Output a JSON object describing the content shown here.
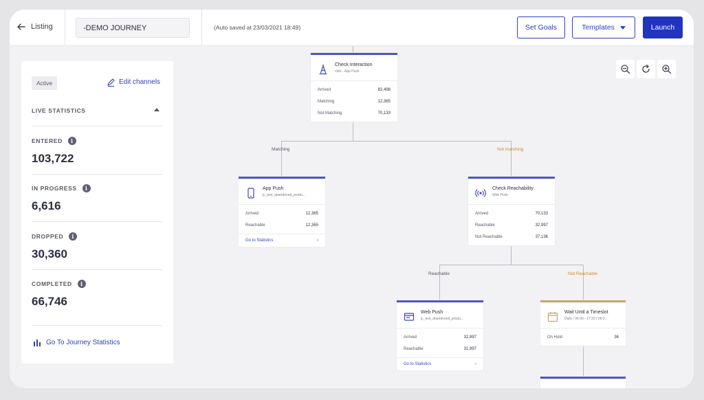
{
  "header": {
    "back_label": "Listing",
    "journey_name": "-DEMO JOURNEY",
    "autosave": "(Auto saved at 23/03/2021 18:49)",
    "set_goals_label": "Set Goals",
    "templates_label": "Templates",
    "launch_label": "Launch"
  },
  "sidebar": {
    "status_badge": "Active",
    "edit_channels_label": "Edit channels",
    "live_statistics_label": "LIVE STATISTICS",
    "stats": [
      {
        "label": "ENTERED",
        "value": "103,722"
      },
      {
        "label": "IN PROGRESS",
        "value": "6,616"
      },
      {
        "label": "DROPPED",
        "value": "30,360"
      },
      {
        "label": "COMPLETED",
        "value": "66,746"
      }
    ],
    "journey_stats_link": "Go To Journey Statistics"
  },
  "canvas": {
    "branches": {
      "matching": "Matching",
      "not_matching": "Not matching",
      "reachable": "Reachable",
      "not_reachable": "Not Reachable"
    },
    "nodes": {
      "check_interaction": {
        "title": "Check Interaction",
        "subtitle": "click - App Push",
        "rows": [
          {
            "label": "Arrived",
            "value": "82,498"
          },
          {
            "label": "Matching",
            "value": "12,365"
          },
          {
            "label": "Not Matching",
            "value": "70,133"
          }
        ]
      },
      "app_push": {
        "title": "App Push",
        "subtitle": "jc_test_abandoned_produ...",
        "rows": [
          {
            "label": "Arrived",
            "value": "12,365"
          },
          {
            "label": "Reachable",
            "value": "12,365"
          }
        ],
        "footer": "Go to Statistics"
      },
      "check_reachability": {
        "title": "Check Reachability",
        "subtitle": "Web Push",
        "rows": [
          {
            "label": "Arrived",
            "value": "70,133"
          },
          {
            "label": "Reachable",
            "value": "32,997"
          },
          {
            "label": "Not Reachable",
            "value": "37,136"
          }
        ]
      },
      "web_push": {
        "title": "Web Push",
        "subtitle": "jc_test_abandoned_produ...",
        "rows": [
          {
            "label": "Arrived",
            "value": "32,997"
          },
          {
            "label": "Reachable",
            "value": "31,997"
          }
        ],
        "footer": "Go to Statistics"
      },
      "wait_until": {
        "title": "Wait Until a Timeslot",
        "subtitle": "Daily / 06:00 - 17:20 / 06:0...",
        "rows": [
          {
            "label": "On Hold",
            "value": "36"
          }
        ]
      }
    }
  },
  "colors": {
    "primary": "#2134c0",
    "node_accent": "#4b55c8",
    "wait_accent": "#c9a36a",
    "negative_branch": "#c98a2e"
  },
  "icons": {
    "back": "arrow-left-icon",
    "edit": "pencil-icon",
    "info": "info-icon",
    "stats": "bar-chart-icon",
    "zoom_out": "zoom-out-icon",
    "refresh": "refresh-icon",
    "zoom_in": "zoom-in-icon"
  }
}
